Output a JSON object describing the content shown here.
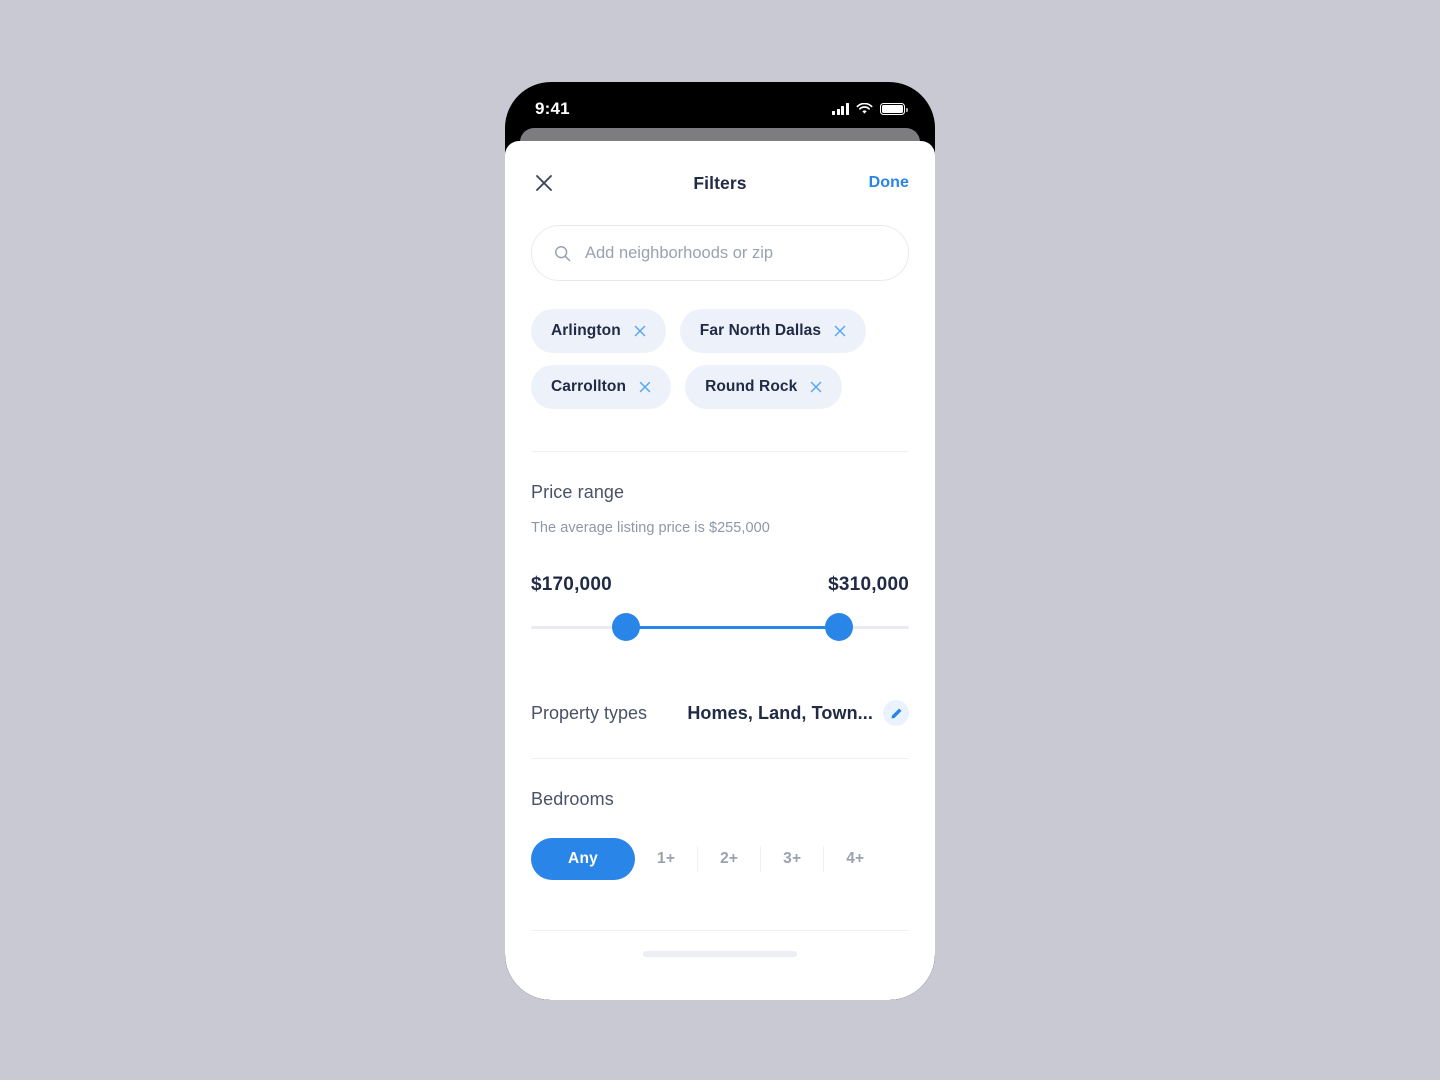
{
  "status_bar": {
    "time": "9:41",
    "signal_icon": "cellular-bars-icon",
    "wifi_icon": "wifi-icon",
    "battery_icon": "battery-icon"
  },
  "header": {
    "close_icon": "close-icon",
    "title": "Filters",
    "done_label": "Done"
  },
  "search": {
    "icon": "search-icon",
    "placeholder": "Add neighborhoods or zip",
    "value": ""
  },
  "chips": [
    {
      "label": "Arlington",
      "remove_icon": "close-x-icon"
    },
    {
      "label": "Far North Dallas",
      "remove_icon": "close-x-icon"
    },
    {
      "label": "Carrollton",
      "remove_icon": "close-x-icon"
    },
    {
      "label": "Round Rock",
      "remove_icon": "close-x-icon"
    }
  ],
  "price_range": {
    "title": "Price range",
    "subtitle": "The average listing price is $255,000",
    "average_price": "$255,000",
    "min_label": "$170,000",
    "max_label": "$310,000",
    "min_percent": 23,
    "max_percent": 84
  },
  "property_types": {
    "label": "Property types",
    "value": "Homes, Land, Town...",
    "edit_icon": "pencil-edit-icon"
  },
  "bedrooms": {
    "title": "Bedrooms",
    "options": [
      {
        "label": "Any",
        "selected": true
      },
      {
        "label": "1+",
        "selected": false
      },
      {
        "label": "2+",
        "selected": false
      },
      {
        "label": "3+",
        "selected": false
      },
      {
        "label": "4+",
        "selected": false
      }
    ]
  },
  "colors": {
    "accent_blue": "#2a85e8",
    "chip_bg": "#edf1f9",
    "text_dark": "#222b45",
    "text_muted": "#8e97a7",
    "page_bg": "#c8c9d3"
  }
}
